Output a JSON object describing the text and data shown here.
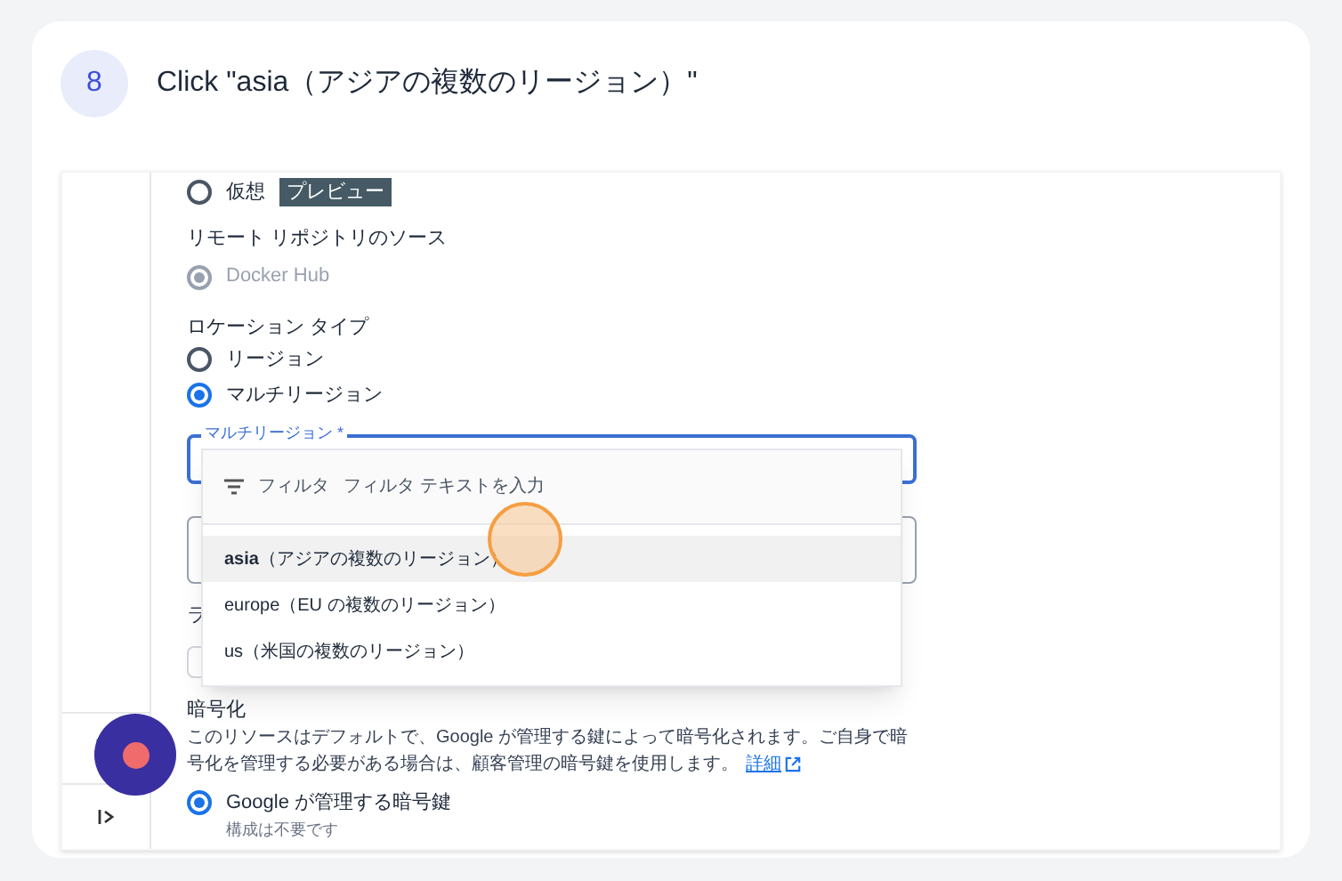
{
  "step": {
    "number": "8",
    "title": "Click \"asia（アジアの複数のリージョン）\""
  },
  "mode_options": [
    {
      "label": "仮想",
      "badge": "プレビュー",
      "selected": false
    }
  ],
  "remote_source": {
    "label": "リモート リポジトリのソース",
    "options": [
      {
        "label": "Docker Hub",
        "selected": true,
        "disabled": true
      }
    ]
  },
  "location_type": {
    "label": "ロケーション タイプ",
    "options": [
      {
        "label": "リージョン",
        "selected": false
      },
      {
        "label": "マルチリージョン",
        "selected": true
      }
    ]
  },
  "multi_region_field": {
    "label": "マルチリージョン *"
  },
  "dropdown": {
    "filter_label": "フィルタ",
    "filter_placeholder": "フィルタ テキストを入力",
    "options": [
      {
        "label": "**asia**（アジアの複数のリージョン）",
        "selected": true
      },
      {
        "label": "europe（EU の複数のリージョン）",
        "selected": false
      },
      {
        "label": "us（米国の複数のリージョン）",
        "selected": false
      }
    ]
  },
  "covered_label": "ラ",
  "encryption": {
    "title": "暗号化",
    "description": "このリソースはデフォルトで、Google が管理する鍵によって暗号化されます。ご自身で暗号化を管理する必要がある場合は、顧客管理の暗号鍵を使用します。",
    "link": "詳細",
    "options": [
      {
        "label": "Google が管理する暗号鍵",
        "selected": true,
        "note": "構成は不要です"
      }
    ]
  }
}
